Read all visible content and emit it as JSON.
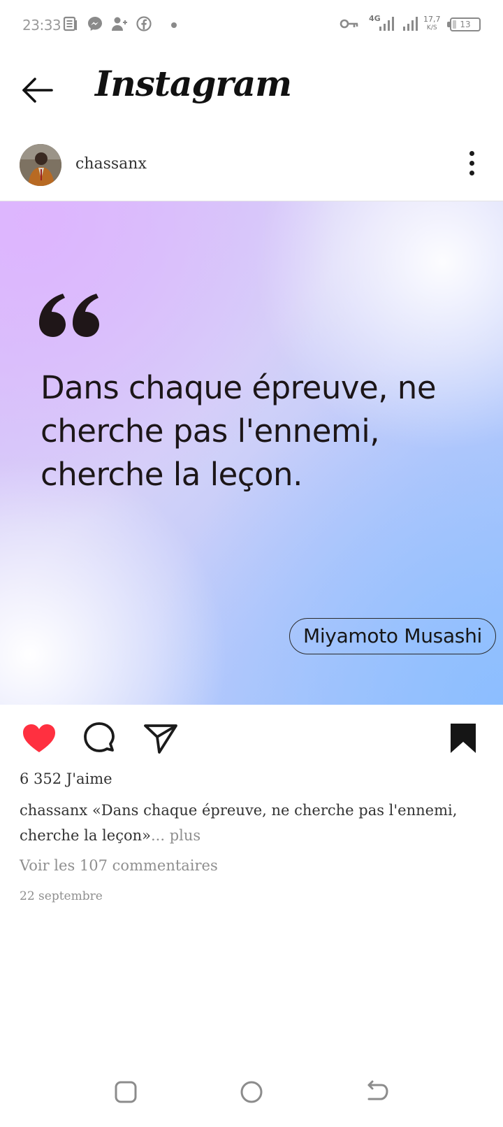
{
  "status_bar": {
    "time": "23:33",
    "network": "4G",
    "speed_value": "17,7",
    "speed_unit": "K/S",
    "battery_level": "13",
    "icons": [
      "news-icon",
      "messenger-icon",
      "add-user-icon",
      "facebook-icon",
      "dot-icon",
      "key-icon",
      "signal-icon",
      "signal-icon",
      "battery-icon"
    ]
  },
  "header": {
    "app_title": "Instagram",
    "back_icon": "arrow-left-icon"
  },
  "post": {
    "username": "chassanx",
    "more_icon": "more-vertical-icon",
    "image": {
      "quote_lines": [
        "Dans chaque épreuve, ne",
        "cherche pas l'ennemi,",
        "cherche la leçon."
      ],
      "author": "Miyamoto Musashi",
      "colors": {
        "top_left": "#d7b8fa",
        "bottom_right": "#9fc3fc",
        "text": "#1c1618"
      }
    },
    "actions": {
      "like_icon": "heart-filled-icon",
      "comment_icon": "comment-icon",
      "share_icon": "send-icon",
      "save_icon": "bookmark-filled-icon",
      "liked": true,
      "like_color": "#ff3040"
    },
    "likes_text": "6 352 J'aime",
    "caption_username": "chassanx",
    "caption_text": "«Dans chaque épreuve, ne cherche pas l'ennemi, cherche la leçon»",
    "caption_ellipsis": "...",
    "caption_more": "plus",
    "comments_link": "Voir les 107 commentaires",
    "date": "22 septembre"
  },
  "nav_bar": {
    "icons": [
      "recents-icon",
      "home-icon",
      "back-icon"
    ]
  }
}
